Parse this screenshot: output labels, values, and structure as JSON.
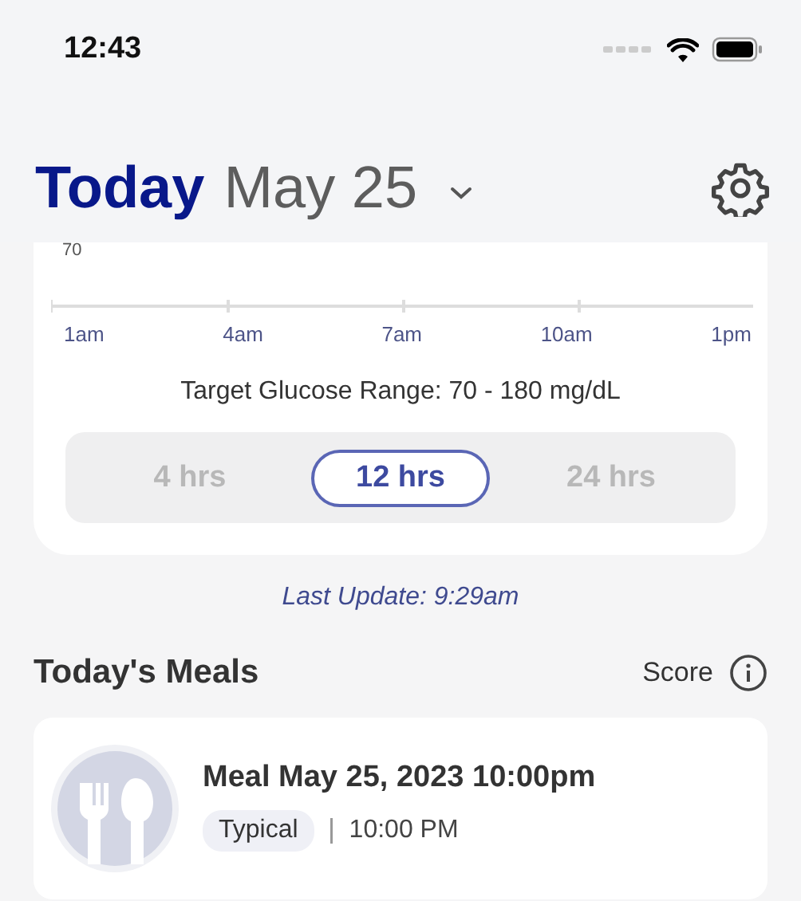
{
  "status_bar": {
    "time": "12:43"
  },
  "header": {
    "title": "Today",
    "date": "May 25"
  },
  "glucose_card": {
    "y_label": "70",
    "x_labels": [
      "1am",
      "4am",
      "7am",
      "10am",
      "1pm"
    ],
    "target_range": "Target Glucose Range: 70 - 180 mg/dL",
    "ranges": [
      {
        "label": "4 hrs",
        "selected": false
      },
      {
        "label": "12 hrs",
        "selected": true
      },
      {
        "label": "24 hrs",
        "selected": false
      }
    ]
  },
  "last_update": "Last Update: 9:29am",
  "meals": {
    "title": "Today's Meals",
    "score_label": "Score",
    "items": [
      {
        "title": "Meal May 25, 2023 10:00pm",
        "tag": "Typical",
        "time": "10:00 PM"
      }
    ]
  }
}
